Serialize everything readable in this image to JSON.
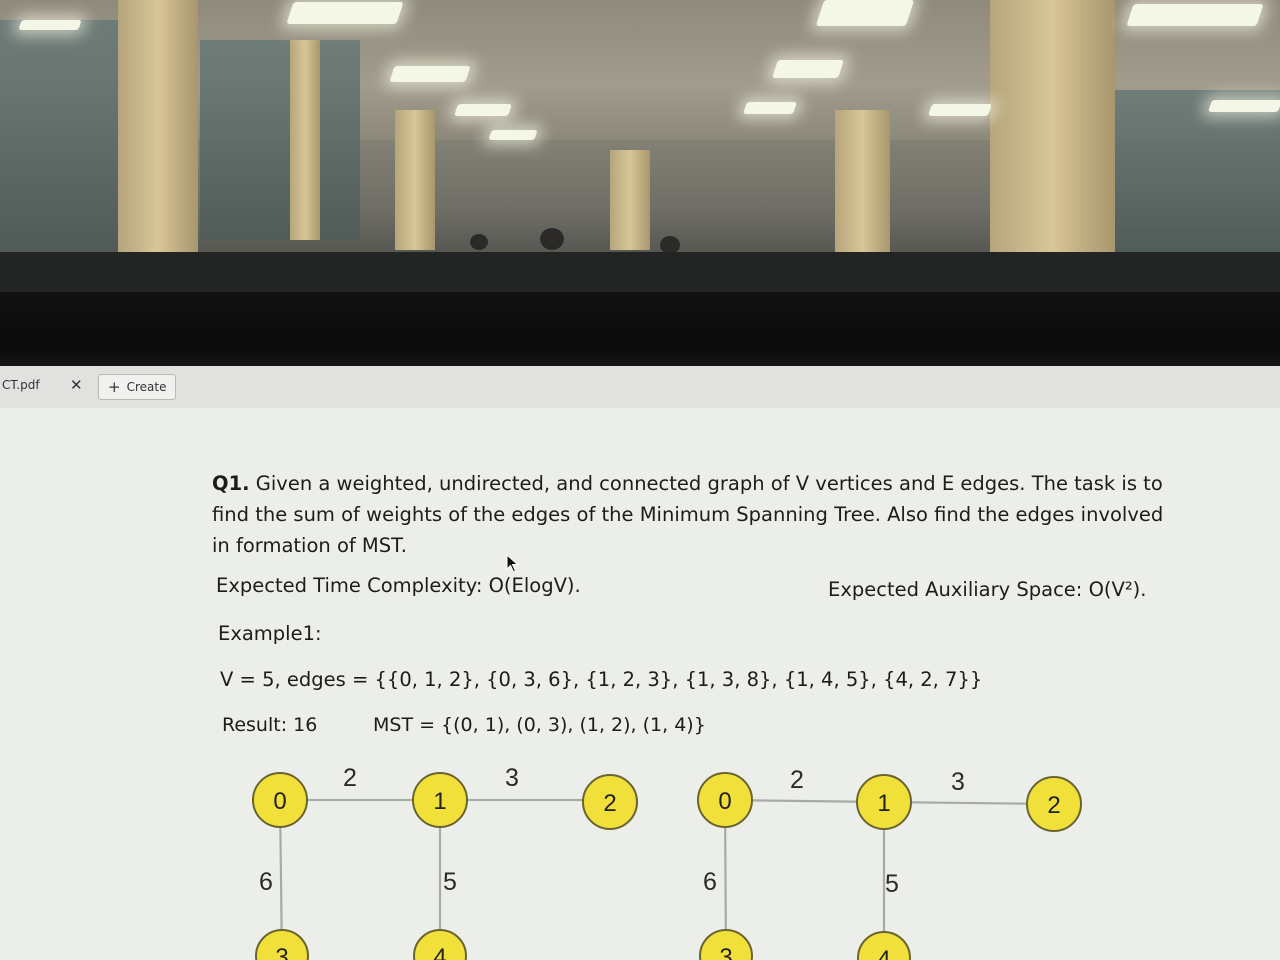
{
  "browser": {
    "tab_file": "CT.pdf",
    "tab_close": "✕",
    "create_plus": "+",
    "create_label": "Create"
  },
  "question": {
    "number": "Q1.",
    "text": "Given a weighted, undirected, and connected graph of V vertices and E edges. The task is to find the sum of weights of the edges of the Minimum Spanning Tree. Also find the edges involved in formation of MST.",
    "time_complexity": "Expected Time Complexity: O(ElogV).",
    "aux_space": "Expected Auxiliary Space: O(V²).",
    "example_label": "Example1:",
    "edges_line": "V = 5, edges = {{0, 1, 2}, {0, 3, 6}, {1, 2, 3}, {1, 3, 8}, {1, 4, 5}, {4, 2, 7}}",
    "result": "Result: 16",
    "mst": "MST = {(0, 1), (0, 3), (1, 2), (1, 4)}"
  },
  "graphs": [
    {
      "nodes": [
        "0",
        "1",
        "2",
        "3",
        "4"
      ],
      "weights": {
        "e01": "2",
        "e12": "3",
        "e03": "6",
        "e14": "5"
      }
    },
    {
      "nodes": [
        "0",
        "1",
        "2",
        "3",
        "4"
      ],
      "weights": {
        "e01": "2",
        "e12": "3",
        "e03": "6",
        "e14": "5"
      }
    }
  ],
  "colors": {
    "node_fill": "#f2e03a",
    "screen_bg": "#eceeea",
    "bezel": "#0f0f0f"
  }
}
